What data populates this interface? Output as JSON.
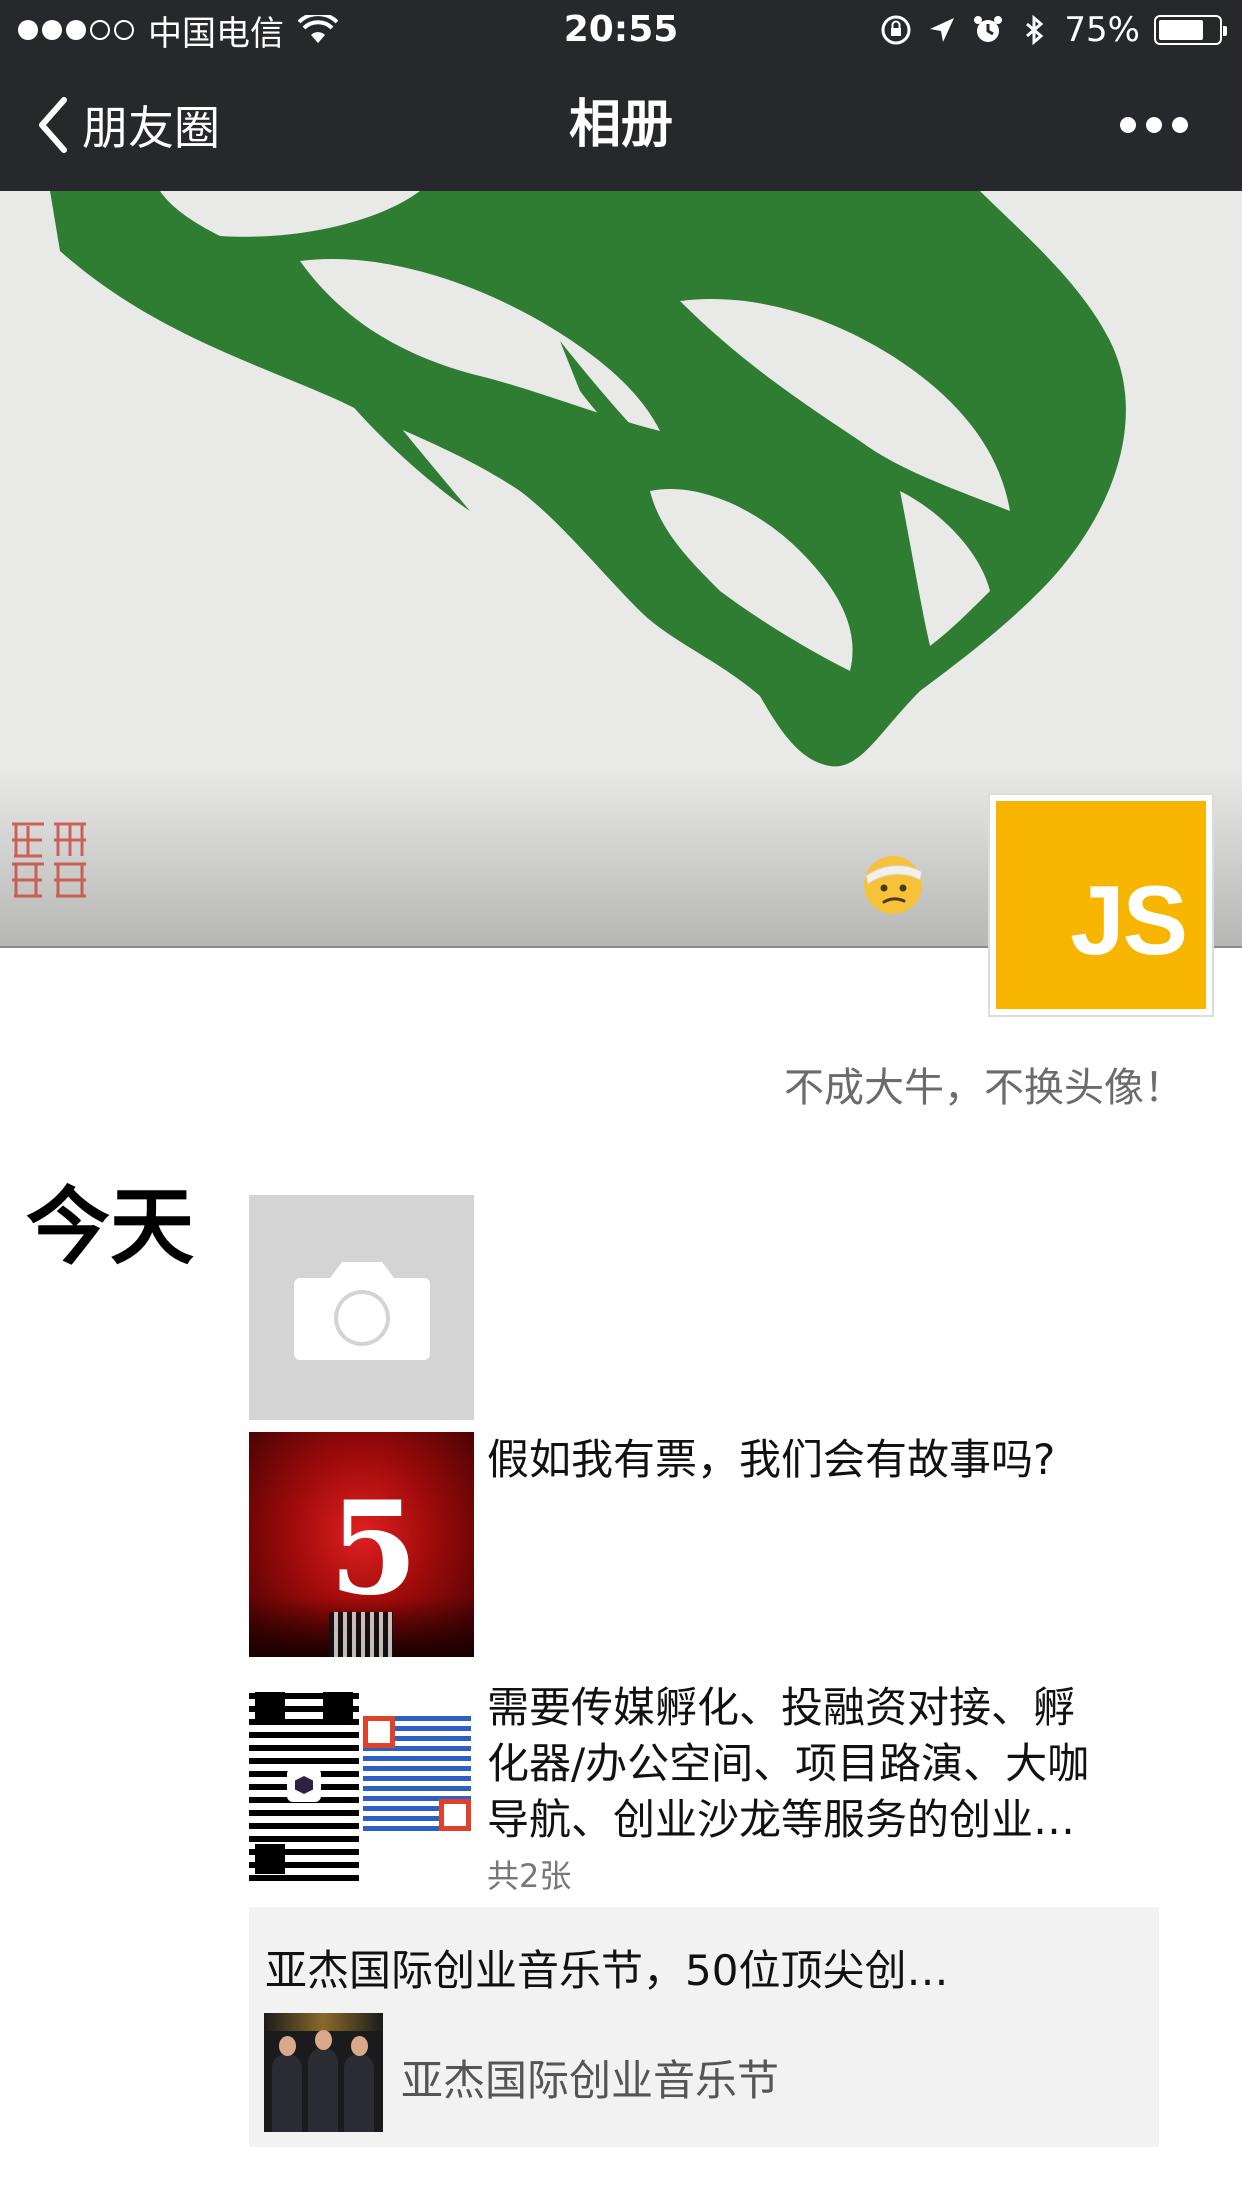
{
  "status_bar": {
    "carrier": "中国电信",
    "time": "20:55",
    "battery": "75%",
    "battery_level": 0.75,
    "signal_bars_filled": 3,
    "signal_bars_total": 5,
    "icons": [
      "wifi-icon",
      "rotation-lock-icon",
      "location-arrow-icon",
      "alarm-icon",
      "bluetooth-icon",
      "battery-icon"
    ]
  },
  "nav": {
    "back_label": "朋友圈",
    "title": "相册",
    "more_icon": "more-dots-icon"
  },
  "cover": {
    "colors": {
      "background": "#e9e9e8",
      "brush": "#2e7d32",
      "seal": "#c9453a"
    }
  },
  "profile": {
    "avatar_text": "JS",
    "avatar_color": "#f7b500",
    "signature": "不成大牛，不换头像！"
  },
  "timeline": {
    "day_label": "今天",
    "camera_icon": "camera-icon",
    "posts": [
      {
        "text": "假如我有票，我们会有故事吗?",
        "thumb": {
          "big_number": "5"
        }
      },
      {
        "text_lines": [
          "需要传媒孵化、投融资对接、孵",
          "化器/办公空间、项目路演、大咖",
          "导航、创业沙龙等服务的创业…"
        ],
        "count": "共2张"
      }
    ],
    "share": {
      "title": "亚杰国际创业音乐节，50位顶尖创…",
      "source": "亚杰国际创业音乐节"
    }
  }
}
